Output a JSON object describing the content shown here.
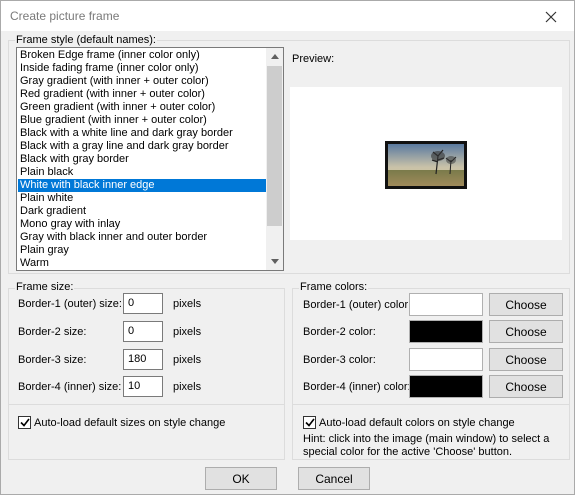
{
  "window": {
    "title": "Create picture frame"
  },
  "frame_style": {
    "group_label": "Frame style (default names):",
    "items": [
      "Broken Edge frame (inner color only)",
      "Inside fading frame (inner color only)",
      "Gray gradient (with inner + outer color)",
      "Red gradient (with inner + outer color)",
      "Green gradient (with inner + outer color)",
      "Blue gradient (with inner + outer color)",
      "Black with a white line and dark gray border",
      "Black with a gray line and dark gray border",
      "Black with gray border",
      "Plain black",
      "White with black inner edge",
      "Plain white",
      "Dark gradient",
      "Mono gray with inlay",
      "Gray with black inner and outer border",
      "Plain gray",
      "Warm"
    ],
    "selected_item": "White with black inner edge"
  },
  "preview": {
    "label": "Preview:"
  },
  "frame_size": {
    "group_label": "Frame size:",
    "unit": "pixels",
    "fields": [
      {
        "label": "Border-1 (outer) size:",
        "value": "0"
      },
      {
        "label": "Border-2 size:",
        "value": "0"
      },
      {
        "label": "Border-3 size:",
        "value": "180"
      },
      {
        "label": "Border-4 (inner) size:",
        "value": "10"
      }
    ],
    "autoload_label": "Auto-load default sizes on style change",
    "autoload_checked": true
  },
  "frame_colors": {
    "group_label": "Frame colors:",
    "choose_label": "Choose",
    "fields": [
      {
        "label": "Border-1 (outer) color:",
        "color": "#ffffff"
      },
      {
        "label": "Border-2 color:",
        "color": "#000000"
      },
      {
        "label": "Border-3 color:",
        "color": "#ffffff"
      },
      {
        "label": "Border-4 (inner) color:",
        "color": "#000000"
      }
    ],
    "autoload_label": "Auto-load default colors on style change",
    "autoload_checked": true,
    "hint_line1": "Hint: click into the image (main window) to select a",
    "hint_line2": "special color for the active 'Choose' button."
  },
  "buttons": {
    "ok": "OK",
    "cancel": "Cancel"
  },
  "colors": {
    "selection": "#0078d7",
    "dialog_bg": "#f0f0f0"
  }
}
